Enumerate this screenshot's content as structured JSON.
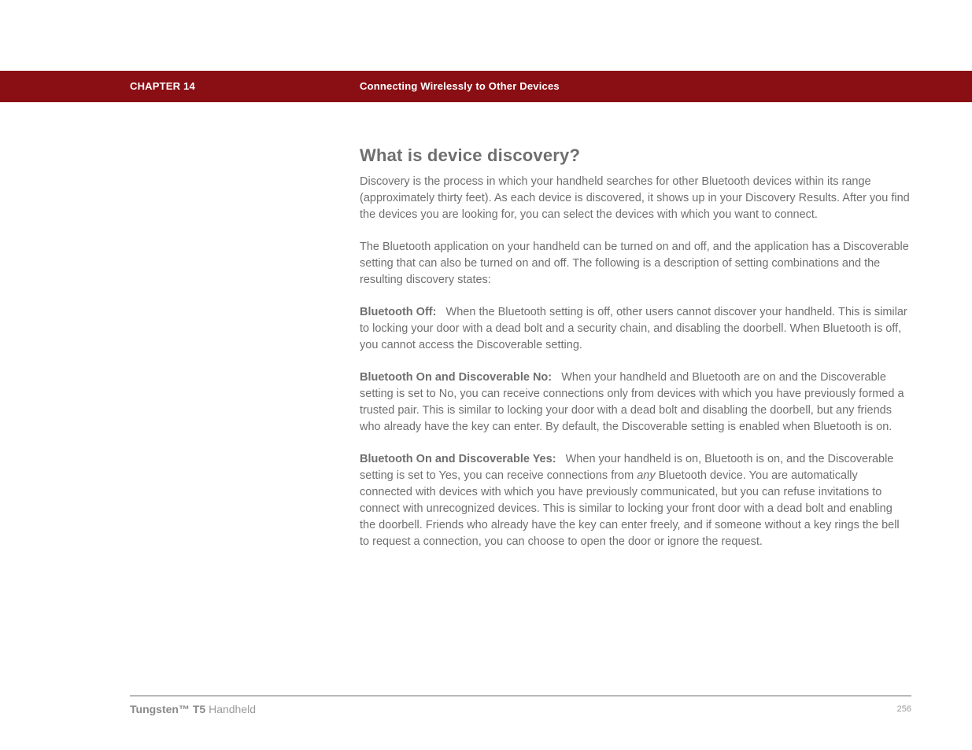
{
  "header": {
    "chapter": "CHAPTER 14",
    "title": "Connecting Wirelessly to Other Devices"
  },
  "main": {
    "heading": "What is device discovery?",
    "intro1": "Discovery is the process in which your handheld searches for other Bluetooth devices within its range (approximately thirty feet). As each device is discovered, it shows up in your Discovery Results. After you find the devices you are looking for, you can select the devices with which you want to connect.",
    "intro2": "The Bluetooth application on your handheld can be turned on and off, and the application has a Discoverable setting that can also be turned on and off. The following is a description of setting combinations and the resulting discovery states:",
    "bt_off_label": "Bluetooth Off:",
    "bt_off_text": "When the Bluetooth setting is off, other users cannot discover your handheld. This is similar to locking your door with a dead bolt and a security chain, and disabling the doorbell. When Bluetooth is off, you cannot access the Discoverable setting.",
    "bt_no_label": "Bluetooth On and Discoverable No:",
    "bt_no_text": "When your handheld and Bluetooth are on and the Discoverable setting is set to No, you can receive connections only from devices with which you have previously formed a trusted pair. This is similar to locking your door with a dead bolt and disabling the doorbell, but any friends who already have the key can enter. By default, the Discoverable setting is enabled when Bluetooth is on.",
    "bt_yes_label": "Bluetooth On and Discoverable Yes:",
    "bt_yes_text_a": "When your handheld is on, Bluetooth is on, and the Discoverable setting is set to Yes, you can receive connections from ",
    "bt_yes_any": "any",
    "bt_yes_text_b": " Bluetooth device. You are automatically connected with devices with which you have previously communicated, but you can refuse invitations to connect with unrecognized devices. This is similar to locking your front door with a dead bolt and enabling the doorbell. Friends who already have the key can enter freely, and if someone without a key rings the bell to request a connection, you can choose to open the door or ignore the request."
  },
  "footer": {
    "product_bold": "Tungsten™ T5",
    "product_light": " Handheld",
    "page": "256"
  }
}
